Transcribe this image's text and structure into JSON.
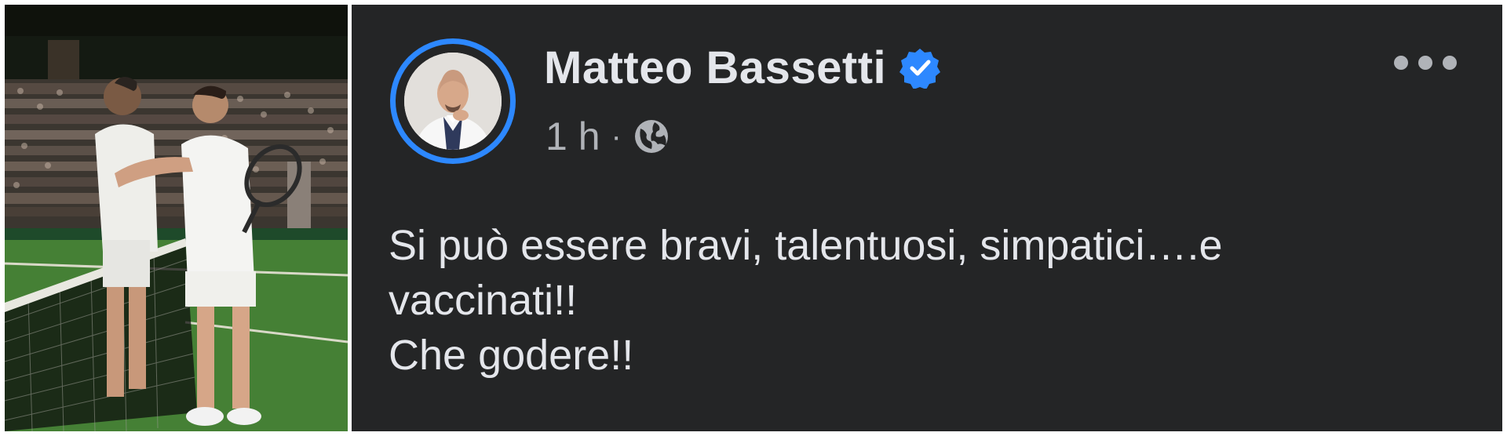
{
  "photo": {
    "alt_subject": "two tennis players embracing at the net"
  },
  "post": {
    "author": "Matteo Bassetti",
    "verified": true,
    "timestamp": "1 h",
    "separator": "·",
    "visibility_icon": "globe-icon",
    "more_icon": "more-options-icon",
    "text_lines": [
      "Si può essere bravi, talentuosi, simpatici….e",
      "vaccinati!!",
      "Che godere!!"
    ]
  },
  "colors": {
    "post_background": "#242526",
    "primary_text": "#e4e6eb",
    "secondary_text": "#b0b3b8",
    "accent_blue": "#2d88ff"
  }
}
